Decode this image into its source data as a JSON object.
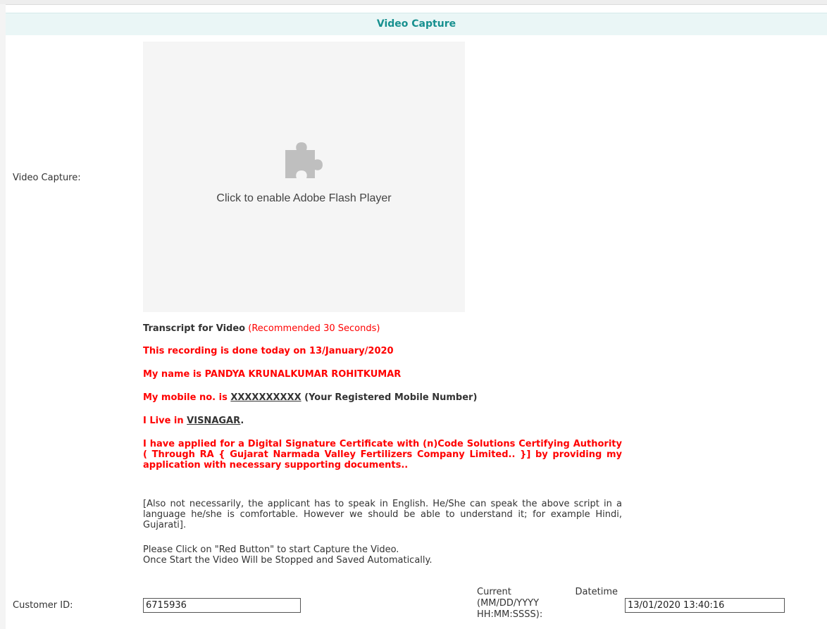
{
  "header": {
    "title": "Video Capture"
  },
  "video": {
    "label": "Video Capture:",
    "flash_text": "Click to enable Adobe Flash Player",
    "icon": "puzzle-icon"
  },
  "transcript": {
    "heading": "Transcript for Video",
    "recommended": "(Recommended 30 Seconds)",
    "line1": "This recording is done today on 13/January/2020",
    "line2": "My name is PANDYA KRUNALKUMAR ROHITKUMAR",
    "line3_prefix": "My mobile no. is",
    "line3_mobile": "XXXXXXXXXX",
    "line3_suffix": "(Your Registered Mobile Number)",
    "line4_prefix": "I Live in",
    "line4_place": "VISNAGAR",
    "line4_suffix": ".",
    "line5": "I have applied for a Digital Signature Certificate with (n)Code Solutions Certifying Authority ( Through RA { Gujarat Narmada Valley Fertilizers Company Limited.. }] by providing my application with necessary supporting documents..",
    "note": "[Also not necessarily, the applicant has to speak in English. He/She can speak the above script in a language he/she is comfortable. However we should be able to understand it; for example Hindi, Gujarati].",
    "instruction1": "Please Click on \"Red Button\" to start Capture the Video.",
    "instruction2": "Once Start the Video Will be Stopped and Saved Automatically."
  },
  "customer": {
    "label": "Customer ID:",
    "value": "6715936"
  },
  "datetime": {
    "label_word1": "Current",
    "label_word2": "Datetime",
    "label_line2": "(MM/DD/YYYY",
    "label_line3": "HH:MM:SSSS):",
    "value": "13/01/2020 13:40:16"
  },
  "colors": {
    "accent": "#17908f",
    "header_bg": "#eaf6f6",
    "transcript_red": "#ff0000"
  }
}
